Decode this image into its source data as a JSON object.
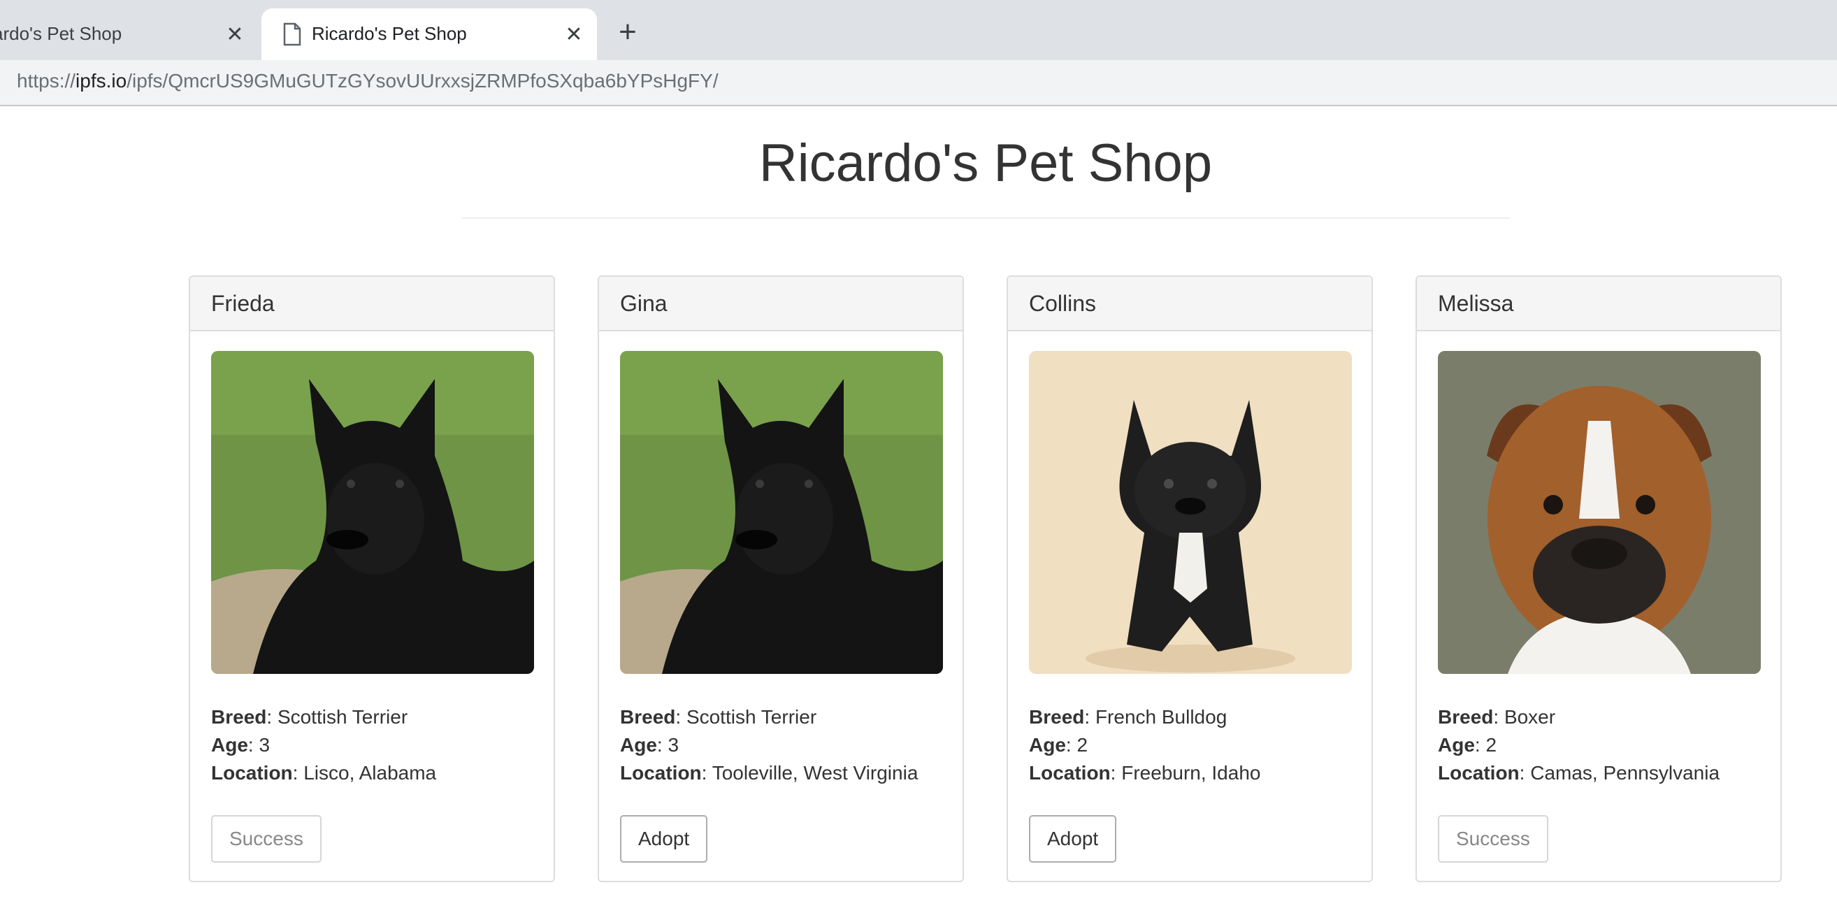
{
  "browser": {
    "tabs": [
      {
        "title": "ardo's Pet Shop",
        "active": false
      },
      {
        "title": "Ricardo's Pet Shop",
        "active": true
      }
    ],
    "close_glyph": "✕",
    "newtab_glyph": "+",
    "url": {
      "scheme": "https://",
      "host": "ipfs.io",
      "path": "/ipfs/QmcrUS9GMuGUTzGYsovUUrxxsjZRMPfoSXqba6bYPsHgFY/"
    }
  },
  "page": {
    "title": "Ricardo's Pet Shop"
  },
  "labels": {
    "breed": "Breed",
    "age": "Age",
    "location": "Location"
  },
  "pets": [
    {
      "name": "Frieda",
      "image": "scottish-terrier-photo",
      "breed": "Scottish Terrier",
      "age": "3",
      "location": "Lisco, Alabama",
      "button": "Success",
      "adopted": true
    },
    {
      "name": "Gina",
      "image": "scottish-terrier-photo",
      "breed": "Scottish Terrier",
      "age": "3",
      "location": "Tooleville, West Virginia",
      "button": "Adopt",
      "adopted": false
    },
    {
      "name": "Collins",
      "image": "french-bulldog-photo",
      "breed": "French Bulldog",
      "age": "2",
      "location": "Freeburn, Idaho",
      "button": "Adopt",
      "adopted": false
    },
    {
      "name": "Melissa",
      "image": "boxer-photo",
      "breed": "Boxer",
      "age": "2",
      "location": "Camas, Pennsylvania",
      "button": "Success",
      "adopted": true
    }
  ],
  "colors": {
    "tabstrip": "#dee1e6",
    "addressbar": "#f1f3f4",
    "card_border": "#dddddd",
    "card_header": "#f5f5f5"
  }
}
